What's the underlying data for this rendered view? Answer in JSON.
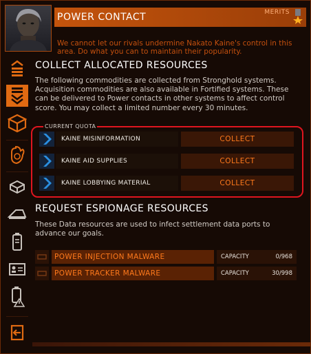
{
  "header": {
    "title": "POWER CONTACT",
    "merits_label": "MERITS",
    "message": "We cannot let our rivals undermine Nakato Kaine's control in this area. Do what you can to maintain their popularity."
  },
  "sidebar": {
    "items": [
      {
        "name": "sidebar-item-stack",
        "icon": "stacked-chevrons-up-icon",
        "active": false
      },
      {
        "name": "sidebar-item-collect",
        "icon": "chevrons-down-icon",
        "active": true
      },
      {
        "name": "sidebar-item-cargo",
        "icon": "cube-icon",
        "active": false
      },
      {
        "name": "sidebar-item-hand",
        "icon": "hand-icon",
        "active": false
      },
      {
        "name": "sidebar-item-material",
        "icon": "box-icon",
        "active": false
      },
      {
        "name": "sidebar-item-ship",
        "icon": "ship-icon",
        "active": false
      },
      {
        "name": "sidebar-item-canister",
        "icon": "canister-icon",
        "active": false
      },
      {
        "name": "sidebar-item-id",
        "icon": "id-card-icon",
        "active": false
      },
      {
        "name": "sidebar-item-warning",
        "icon": "warning-canister-icon",
        "active": false
      },
      {
        "name": "sidebar-item-exit",
        "icon": "exit-icon",
        "active": false
      }
    ]
  },
  "collect": {
    "title": "COLLECT ALLOCATED RESOURCES",
    "description": "The following commodities are collected from Stronghold systems. Acquisition commodities are also available in Fortified systems. These can be delivered to Power contacts in other systems to affect control score. You may collect a limited number every 30 minutes.",
    "quota_label": "CURRENT QUOTA",
    "resources": [
      {
        "name": "KAINE MISINFORMATION",
        "action": "COLLECT"
      },
      {
        "name": "KAINE AID SUPPLIES",
        "action": "COLLECT"
      },
      {
        "name": "KAINE LOBBYING MATERIAL",
        "action": "COLLECT"
      }
    ]
  },
  "espionage": {
    "title": "REQUEST ESPIONAGE RESOURCES",
    "description": "These Data resources are used to infect settlement data ports to advance our goals.",
    "items": [
      {
        "name": "POWER INJECTION MALWARE",
        "capacity_label": "CAPACITY",
        "capacity": "0/968"
      },
      {
        "name": "POWER TRACKER MALWARE",
        "capacity_label": "CAPACITY",
        "capacity": "30/998"
      }
    ]
  },
  "colors": {
    "accent": "#e06a12",
    "header": "#c4540c",
    "highlight_box": "#e0151f",
    "chevron": "#2b8fe0"
  }
}
